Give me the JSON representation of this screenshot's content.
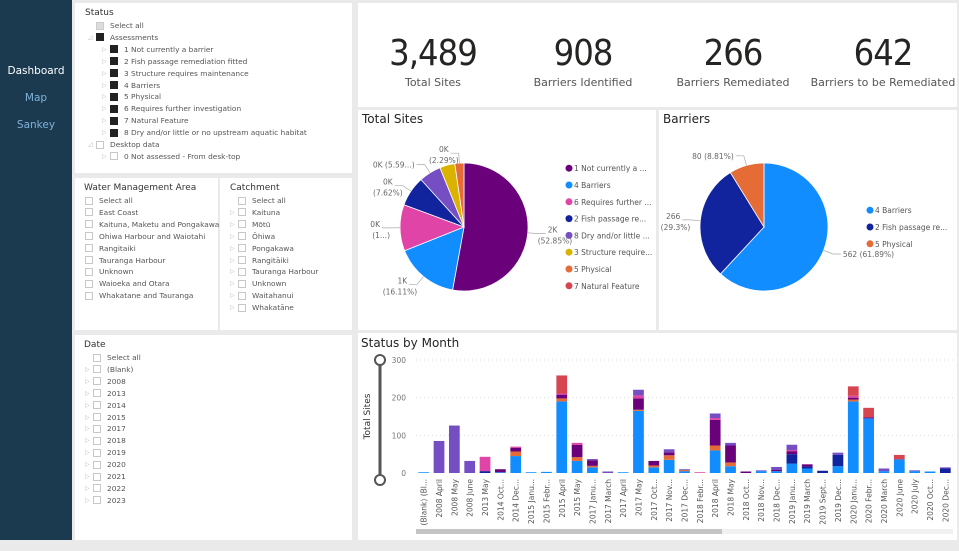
{
  "nav": {
    "items": [
      {
        "label": "Dashboard",
        "active": true
      },
      {
        "label": "Map"
      },
      {
        "label": "Sankey"
      }
    ]
  },
  "status_slicer": {
    "title": "Status",
    "items": [
      {
        "label": "Select all",
        "level": 0,
        "state": "partial",
        "expand": false
      },
      {
        "label": "Assessments",
        "level": 0,
        "state": "on",
        "expand": "open"
      },
      {
        "label": "1 Not currently a barrier",
        "level": 1,
        "state": "on",
        "expand": true
      },
      {
        "label": "2 Fish passage remediation fitted",
        "level": 1,
        "state": "on",
        "expand": true
      },
      {
        "label": "3 Structure requires maintenance",
        "level": 1,
        "state": "on",
        "expand": true
      },
      {
        "label": "4 Barriers",
        "level": 1,
        "state": "on",
        "expand": true
      },
      {
        "label": "5 Physical",
        "level": 1,
        "state": "on",
        "expand": true
      },
      {
        "label": "6 Requires further investigation",
        "level": 1,
        "state": "on",
        "expand": true
      },
      {
        "label": "7 Natural Feature",
        "level": 1,
        "state": "on",
        "expand": true
      },
      {
        "label": "8 Dry and/or little or no upstream aquatic habitat",
        "level": 1,
        "state": "on",
        "expand": true
      },
      {
        "label": "Desktop data",
        "level": 0,
        "state": "off",
        "expand": "open"
      },
      {
        "label": "0 Not assessed - From desk-top",
        "level": 1,
        "state": "off",
        "expand": true
      }
    ]
  },
  "wma_slicer": {
    "title": "Water Management Area",
    "items": [
      "Select all",
      "East Coast",
      "Kaituna, Maketu and Pongakawa",
      "Ohiwa Harbour and Waiotahi",
      "Rangitaiki",
      "Tauranga Harbour",
      "Unknown",
      "Waioeka and Otara",
      "Whakatane and Tauranga"
    ]
  },
  "catchment_slicer": {
    "title": "Catchment",
    "items": [
      "Select all",
      "Kaituna",
      "Mōtū",
      "Ōhiwa",
      "Pongakawa",
      "Rangitāiki",
      "Tauranga Harbour",
      "Unknown",
      "Waitahanui",
      "Whakatāne"
    ]
  },
  "date_slicer": {
    "title": "Date",
    "items": [
      "Select all",
      "(Blank)",
      "2008",
      "2013",
      "2014",
      "2015",
      "2017",
      "2018",
      "2019",
      "2020",
      "2021",
      "2022",
      "2023"
    ]
  },
  "kpis": [
    {
      "value": "3,489",
      "label": "Total Sites"
    },
    {
      "value": "908",
      "label": "Barriers Identified"
    },
    {
      "value": "266",
      "label": "Barriers Remediated"
    },
    {
      "value": "642",
      "label": "Barriers to be Remediated"
    }
  ],
  "colors": {
    "1 Not currently a barrier": "#6b007b",
    "4 Barriers": "#118dff",
    "6 Requires further investigation": "#e044a7",
    "2 Fish passage remediation fitted": "#12239e",
    "8 Dry and/or little or no upstream aquatic habitat": "#744ec2",
    "3 Structure requires maintenance": "#d9b300",
    "5 Physical": "#e66c37",
    "7 Natural Feature": "#d64550"
  },
  "chart_data": [
    {
      "type": "pie",
      "title": "Total Sites",
      "legend_position": "right",
      "slices": [
        {
          "name": "1 Not currently a barrier",
          "legend": "1 Not currently a ...",
          "value": 1844,
          "label": "2K",
          "pct": "(52.85%)"
        },
        {
          "name": "4 Barriers",
          "legend": "4 Barriers",
          "value": 562,
          "label": "1K",
          "pct": "(16.11%)"
        },
        {
          "name": "6 Requires further investigation",
          "legend": "6 Requires further ...",
          "value": 408,
          "label": "0K",
          "pct": "(1...)"
        },
        {
          "name": "2 Fish passage remediation fitted",
          "legend": "2 Fish passage re...",
          "value": 266,
          "label": "0K",
          "pct": "(7.62%)"
        },
        {
          "name": "8 Dry and/or little or no upstream aquatic habitat",
          "legend": "8 Dry and/or little ...",
          "value": 195,
          "label": "0K (5.59...)",
          "pct": ""
        },
        {
          "name": "3 Structure requires maintenance",
          "legend": "3 Structure require...",
          "value": 134,
          "label": "",
          "pct": ""
        },
        {
          "name": "5 Physical",
          "legend": "5 Physical",
          "value": 80,
          "label": "0K",
          "pct": "(2.29%)"
        },
        {
          "name": "7 Natural Feature",
          "legend": "7 Natural Feature",
          "value": 0,
          "label": "",
          "pct": ""
        }
      ]
    },
    {
      "type": "pie",
      "title": "Barriers",
      "legend_position": "right",
      "slices": [
        {
          "name": "4 Barriers",
          "legend": "4 Barriers",
          "value": 562,
          "label": "562 (61.89%)",
          "pct": ""
        },
        {
          "name": "2 Fish passage remediation fitted",
          "legend": "2 Fish passage re...",
          "value": 266,
          "label": "266",
          "pct": "(29.3%)"
        },
        {
          "name": "5 Physical",
          "legend": "5 Physical",
          "value": 80,
          "label": "80 (8.81%)",
          "pct": ""
        }
      ]
    },
    {
      "type": "bar",
      "stacked": true,
      "title": "Status by Month",
      "ylabel": "Total Sites",
      "ylim": [
        0,
        300
      ],
      "yticks": [
        0,
        100,
        200,
        300
      ],
      "grid": true,
      "categories": [
        "(Blank) (Bl...",
        "2008 April",
        "2008 May",
        "2008 June",
        "2013 May",
        "2014 Oct...",
        "2014 Dec...",
        "2015 Janu...",
        "2015 Febr...",
        "2015 April",
        "2015 May",
        "2017 Janu...",
        "2017 March",
        "2017 April",
        "2017 May",
        "2017 Oct...",
        "2017 Nov...",
        "2017 Dec...",
        "2018 Febr...",
        "2018 April",
        "2018 May",
        "2018 Oct...",
        "2018 Nov...",
        "2018 Dec...",
        "2019 Janu...",
        "2019 March",
        "2019 Sept...",
        "2019 Dec...",
        "2020 Janu...",
        "2020 Febr...",
        "2020 March",
        "2020 June",
        "2020 July",
        "2020 Oct...",
        "2020 Dec..."
      ],
      "series": [
        {
          "name": "4 Barriers",
          "values": [
            2,
            0,
            0,
            0,
            0,
            2,
            45,
            2,
            3,
            190,
            32,
            15,
            0,
            2,
            165,
            15,
            35,
            5,
            0,
            60,
            18,
            0,
            5,
            5,
            25,
            12,
            0,
            18,
            190,
            145,
            5,
            36,
            5,
            4,
            0
          ]
        },
        {
          "name": "2 Fish passage remediation fitted",
          "values": [
            0,
            0,
            0,
            0,
            5,
            0,
            0,
            0,
            0,
            0,
            0,
            0,
            0,
            0,
            0,
            0,
            0,
            0,
            0,
            0,
            0,
            0,
            0,
            0,
            25,
            5,
            6,
            30,
            0,
            0,
            0,
            0,
            0,
            0,
            12
          ]
        },
        {
          "name": "5 Physical",
          "values": [
            0,
            0,
            0,
            0,
            0,
            0,
            12,
            0,
            0,
            8,
            10,
            4,
            0,
            0,
            3,
            5,
            12,
            3,
            0,
            13,
            10,
            0,
            0,
            0,
            0,
            0,
            0,
            0,
            5,
            0,
            0,
            0,
            0,
            0,
            0
          ]
        },
        {
          "name": "1 Not currently a barrier",
          "values": [
            0,
            0,
            0,
            0,
            0,
            8,
            10,
            0,
            0,
            10,
            33,
            15,
            0,
            0,
            30,
            12,
            8,
            0,
            0,
            68,
            45,
            4,
            0,
            3,
            8,
            6,
            0,
            0,
            5,
            3,
            0,
            0,
            0,
            0,
            0
          ]
        },
        {
          "name": "6 Requires further investigation",
          "values": [
            0,
            0,
            0,
            0,
            38,
            0,
            3,
            0,
            0,
            3,
            5,
            0,
            0,
            0,
            8,
            0,
            0,
            0,
            2,
            5,
            0,
            0,
            0,
            0,
            3,
            0,
            0,
            0,
            5,
            0,
            0,
            0,
            0,
            0,
            0
          ]
        },
        {
          "name": "8 Dry and/or little or no upstream aquatic habitat",
          "values": [
            0,
            85,
            126,
            32,
            0,
            0,
            0,
            0,
            0,
            0,
            0,
            3,
            4,
            0,
            15,
            0,
            8,
            2,
            0,
            12,
            7,
            0,
            2,
            8,
            14,
            0,
            0,
            6,
            0,
            0,
            7,
            0,
            2,
            0,
            3
          ]
        },
        {
          "name": "7 Natural Feature",
          "values": [
            0,
            0,
            0,
            0,
            0,
            0,
            0,
            0,
            0,
            48,
            0,
            0,
            0,
            0,
            0,
            0,
            0,
            0,
            0,
            0,
            0,
            0,
            0,
            0,
            0,
            0,
            0,
            0,
            25,
            25,
            0,
            12,
            0,
            0,
            0
          ]
        }
      ]
    }
  ]
}
